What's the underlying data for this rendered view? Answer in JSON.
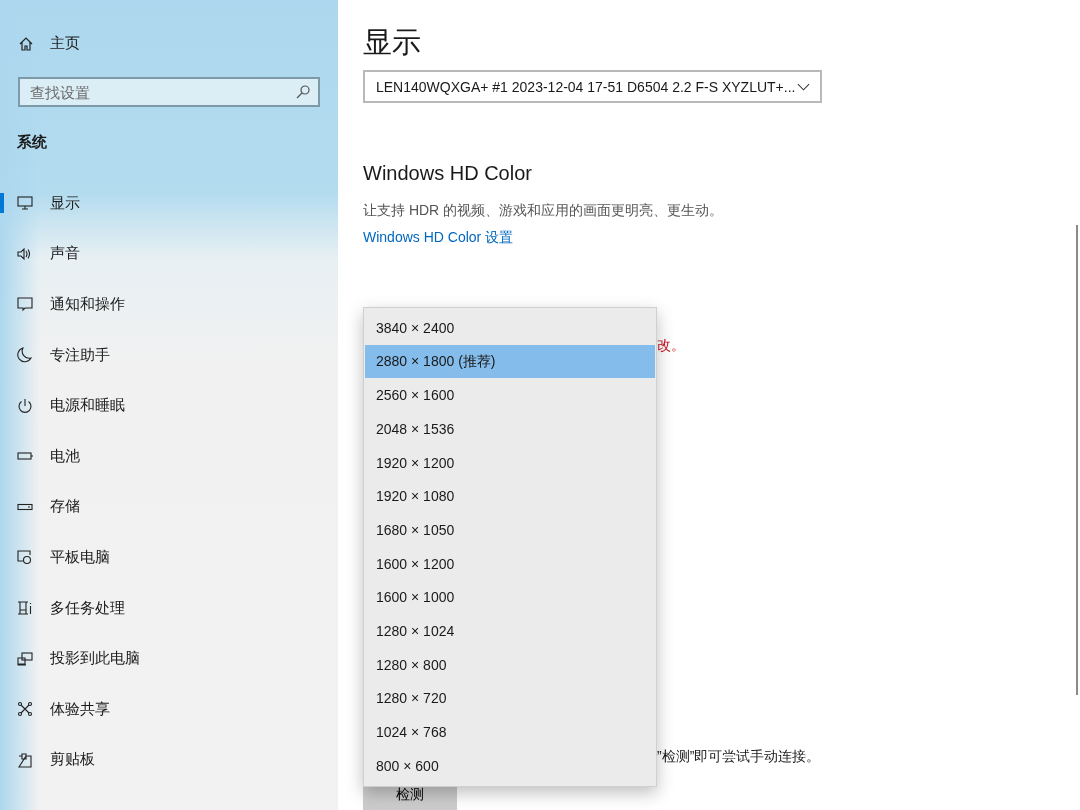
{
  "sidebar": {
    "home": "主页",
    "search": {
      "placeholder": "查找设置"
    },
    "section": "系统",
    "items": [
      {
        "label": "显示",
        "selected": true
      },
      {
        "label": "声音",
        "selected": false
      },
      {
        "label": "通知和操作",
        "selected": false
      },
      {
        "label": "专注助手",
        "selected": false
      },
      {
        "label": "电源和睡眠",
        "selected": false
      },
      {
        "label": "电池",
        "selected": false
      },
      {
        "label": "存储",
        "selected": false
      },
      {
        "label": "平板电脑",
        "selected": false
      },
      {
        "label": "多任务处理",
        "selected": false
      },
      {
        "label": "投影到此电脑",
        "selected": false
      },
      {
        "label": "体验共享",
        "selected": false
      },
      {
        "label": "剪贴板",
        "selected": false
      }
    ]
  },
  "main": {
    "title": "显示",
    "monitor_select": {
      "value": "LEN140WQXGA+ #1 2023-12-04 17-51 D6504 2.2 F-S XYZLUT+..."
    },
    "hdr": {
      "heading": "Windows HD Color",
      "description": "让支持 HDR 的视频、游戏和应用的画面更明亮、更生动。",
      "link": "Windows HD Color 设置"
    },
    "warning": "改。",
    "detect_text": "”检测”即可尝试手动连接。",
    "detect_button": "检测"
  },
  "resolution_dropdown": {
    "options": [
      {
        "label": "3840 × 2400",
        "selected": false
      },
      {
        "label": "2880 × 1800 (推荐)",
        "selected": true
      },
      {
        "label": "2560 × 1600",
        "selected": false
      },
      {
        "label": "2048 × 1536",
        "selected": false
      },
      {
        "label": "1920 × 1200",
        "selected": false
      },
      {
        "label": "1920 × 1080",
        "selected": false
      },
      {
        "label": "1680 × 1050",
        "selected": false
      },
      {
        "label": "1600 × 1200",
        "selected": false
      },
      {
        "label": "1600 × 1000",
        "selected": false
      },
      {
        "label": "1280 × 1024",
        "selected": false
      },
      {
        "label": "1280 × 800",
        "selected": false
      },
      {
        "label": "1280 × 720",
        "selected": false
      },
      {
        "label": "1024 × 768",
        "selected": false
      },
      {
        "label": "800 × 600",
        "selected": false
      }
    ]
  }
}
